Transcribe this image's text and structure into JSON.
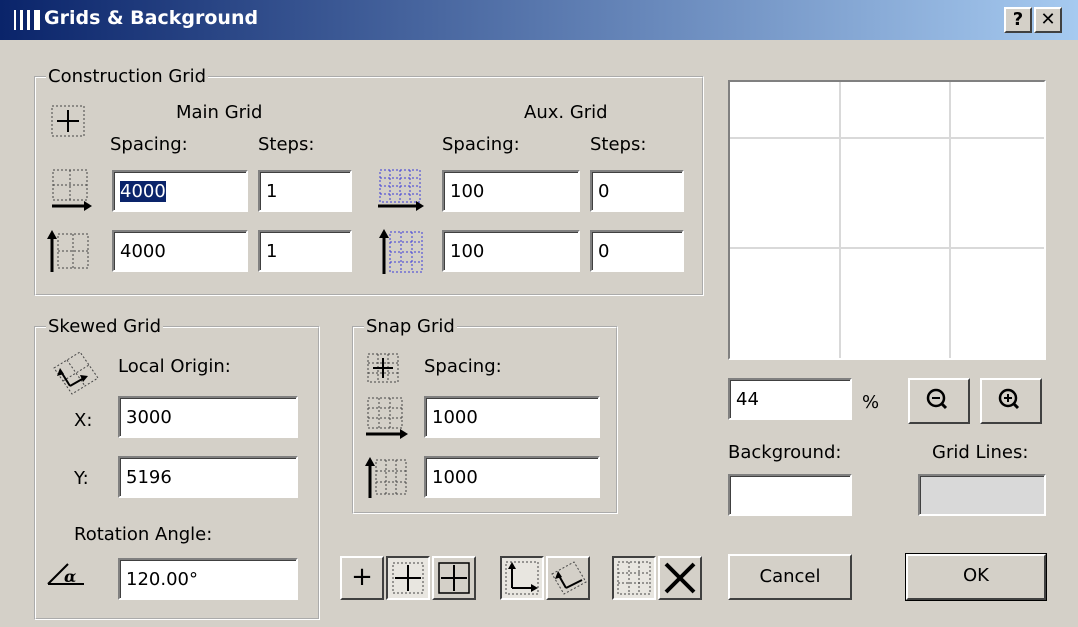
{
  "window": {
    "title": "Grids & Background",
    "help_label": "?",
    "close_label": "✕"
  },
  "construction": {
    "legend": "Construction Grid",
    "main_grid_label": "Main Grid",
    "aux_grid_label": "Aux. Grid",
    "spacing_label": "Spacing:",
    "steps_label": "Steps:",
    "main_h_spacing": "4000",
    "main_h_steps": "1",
    "main_v_spacing": "4000",
    "main_v_steps": "1",
    "aux_h_spacing": "100",
    "aux_h_steps": "0",
    "aux_v_spacing": "100",
    "aux_v_steps": "0"
  },
  "skewed": {
    "legend": "Skewed Grid",
    "origin_label": "Local Origin:",
    "x_label": "X:",
    "x_value": "3000",
    "y_label": "Y:",
    "y_value": "5196",
    "rotation_label": "Rotation Angle:",
    "rotation_value": "120.00°"
  },
  "snap": {
    "legend": "Snap Grid",
    "spacing_label": "Spacing:",
    "h_spacing": "1000",
    "v_spacing": "1000"
  },
  "preview": {
    "zoom_value": "44",
    "zoom_unit": "%",
    "background_label": "Background:",
    "gridlines_label": "Grid Lines:",
    "background_color": "#ffffff",
    "gridlines_color": "#d9d9d9"
  },
  "grid_mode_buttons": {
    "plus": "+"
  },
  "buttons": {
    "cancel": "Cancel",
    "ok": "OK"
  },
  "colors": {
    "title_start": "#0a246a",
    "title_end": "#a6caf0",
    "face": "#d4d0c8",
    "selection": "#0a246a",
    "aux_icon": "#3b3bd8"
  }
}
